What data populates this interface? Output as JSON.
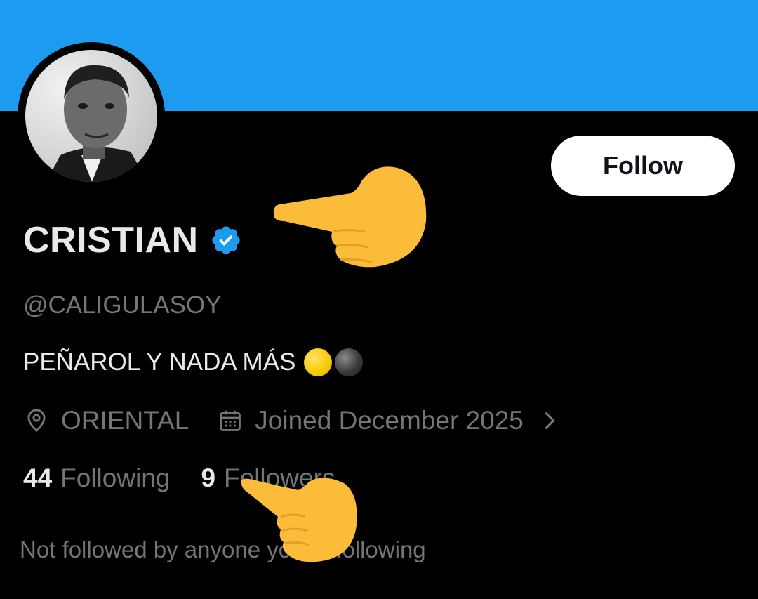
{
  "profile": {
    "display_name": "CRISTIAN",
    "handle": "@CALIGULASOY",
    "bio": "PEÑAROL Y NADA MÁS",
    "location": "ORIENTAL",
    "joined": "Joined December 2025",
    "verified": true
  },
  "actions": {
    "follow_label": "Follow"
  },
  "stats": {
    "following_count": "44",
    "following_label": "Following",
    "followers_count": "9",
    "followers_label": "Followers"
  },
  "social_context": "Not followed by anyone you're following",
  "icons": {
    "verified": "verified-badge-icon",
    "location": "location-pin-icon",
    "calendar": "calendar-icon",
    "chevron": "chevron-right-icon",
    "pointing": "backhand-index-pointing-left-emoji"
  },
  "colors": {
    "banner": "#1d9bf0",
    "background": "#000000",
    "primary_text": "#e7e9ea",
    "secondary_text": "#71767b",
    "verified": "#1d9bf0",
    "follow_button_bg": "#ffffff",
    "follow_button_text": "#0f1419"
  }
}
